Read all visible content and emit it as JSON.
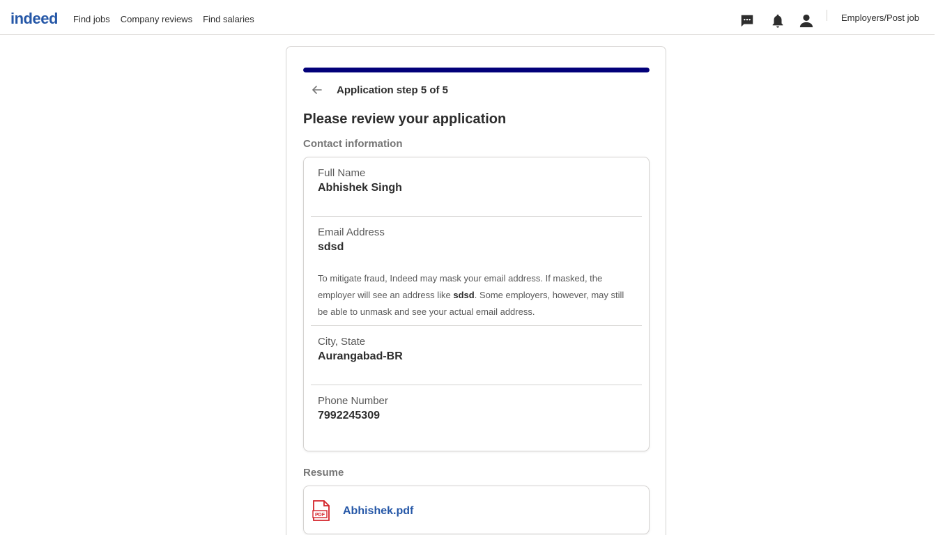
{
  "header": {
    "logo_text": "indeed",
    "nav": [
      "Find jobs",
      "Company reviews",
      "Find salaries"
    ],
    "employers_label": "Employers/Post job",
    "icons": [
      "messages-icon",
      "notifications-icon",
      "profile-icon"
    ]
  },
  "application": {
    "step_title": "Application step 5 of 5",
    "progress_percent": 100,
    "review_title": "Please review your application",
    "contact_section_label": "Contact information",
    "fields": [
      {
        "label": "Full Name",
        "value": "Abhishek Singh"
      },
      {
        "label": "Email Address",
        "value": "sdsd"
      },
      {
        "label": "City, State",
        "value": "Aurangabad-BR"
      },
      {
        "label": "Phone Number",
        "value": "7992245309"
      }
    ],
    "email_note_part1": "To mitigate fraud, Indeed may mask your email address. If masked, the employer will see an address like ",
    "email_note_bold": "sdsd",
    "email_note_part2": ". Some employers, however, may still be able to unmask and see your actual email address.",
    "resume_section_label": "Resume",
    "resume_file": "Abhishek.pdf",
    "pdf_badge": "PDF"
  },
  "colors": {
    "brand_blue": "#2557a7",
    "progress_navy": "#020079",
    "pdf_red": "#d4232a"
  }
}
